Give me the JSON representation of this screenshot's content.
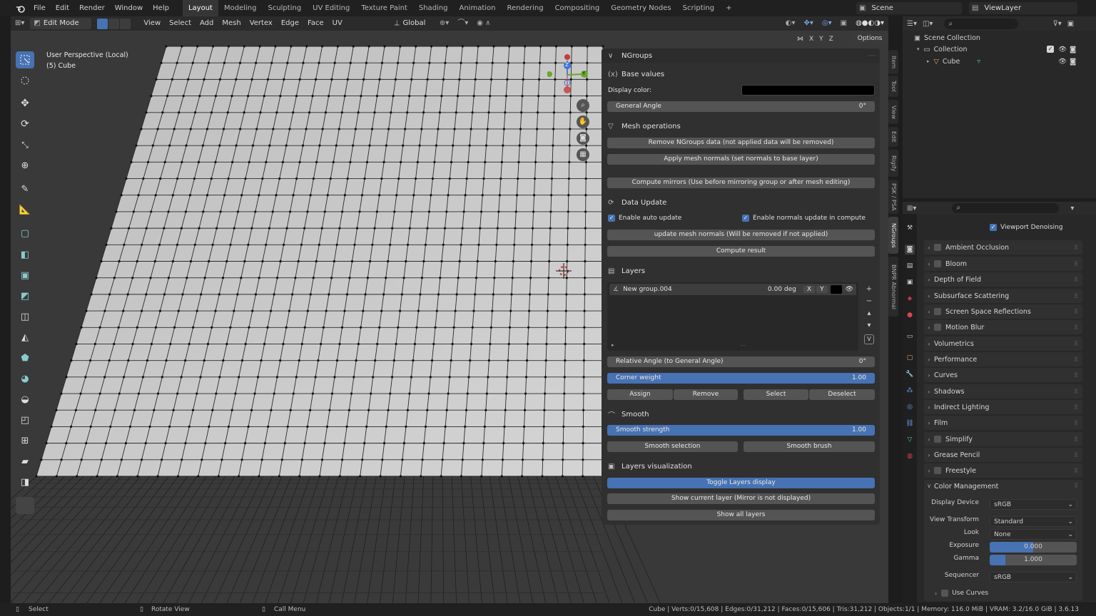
{
  "topbar": {
    "menus": [
      "File",
      "Edit",
      "Render",
      "Window",
      "Help"
    ],
    "workspaces": [
      "Layout",
      "Modeling",
      "Sculpting",
      "UV Editing",
      "Texture Paint",
      "Shading",
      "Animation",
      "Rendering",
      "Compositing",
      "Geometry Nodes",
      "Scripting"
    ],
    "active_workspace": "Layout",
    "add_tab": "+",
    "scene": "Scene",
    "view_layer": "ViewLayer"
  },
  "header": {
    "mode": "Edit Mode",
    "menus": [
      "View",
      "Select",
      "Add",
      "Mesh",
      "Vertex",
      "Edge",
      "Face",
      "UV"
    ],
    "transform_orientation": "Global",
    "options": "Options",
    "axes": [
      "X",
      "Y",
      "Z"
    ]
  },
  "viewport": {
    "perspective": "User Perspective (Local)",
    "object": "(5) Cube",
    "gizmo": {
      "z": "Z",
      "y": "Y"
    }
  },
  "ngroups": {
    "title": "NGroups",
    "base_values": {
      "header": "Base values",
      "display_color_label": "Display color:",
      "display_color": "#000000",
      "general_angle_label": "General Angle",
      "general_angle_value": "0°"
    },
    "mesh_ops": {
      "header": "Mesh operations",
      "remove": "Remove NGroups data (not applied data will be removed)",
      "apply": "Apply mesh normals (set normals to base layer)",
      "mirrors": "Compute mirrors (Use before mirroring group or after mesh editing)"
    },
    "data_update": {
      "header": "Data Update",
      "auto_update": "Enable auto update",
      "normals_update": "Enable normals update in compute",
      "update_normals": "update mesh normals (Will be removed if not applied)",
      "compute": "Compute result"
    },
    "layers": {
      "header": "Layers",
      "item_name": "New group.004",
      "item_angle": "0.00 deg",
      "item_x": "X",
      "item_y": "Y",
      "relative_angle_label": "Relative Angle (to General Angle)",
      "relative_angle_value": "0°",
      "corner_weight_label": "Corner weight",
      "corner_weight_value": "1.00",
      "assign": "Assign",
      "remove": "Remove",
      "select": "Select",
      "deselect": "Deselect"
    },
    "smooth": {
      "header": "Smooth",
      "strength_label": "Smooth strength",
      "strength_value": "1.00",
      "selection": "Smooth selection",
      "brush": "Smooth brush"
    },
    "visualization": {
      "header": "Layers visualization",
      "toggle": "Toggle Layers display",
      "current": "Show current layer (Mirror is not displayed)",
      "all": "Show all layers"
    }
  },
  "sidetabs": [
    "Item",
    "Tool",
    "View",
    "Edit",
    "Rigify",
    "PSK / PSA",
    "NGroups",
    "BNPR Abnormal"
  ],
  "outliner": {
    "scene_collection": "Scene Collection",
    "collection": "Collection",
    "cube": "Cube"
  },
  "properties": {
    "viewport_denoising": "Viewport Denoising",
    "sections": [
      "Ambient Occlusion",
      "Bloom",
      "Depth of Field",
      "Subsurface Scattering",
      "Screen Space Reflections",
      "Motion Blur",
      "Volumetrics",
      "Performance",
      "Curves",
      "Shadows",
      "Indirect Lighting",
      "Film",
      "Simplify",
      "Grease Pencil",
      "Freestyle",
      "Color Management"
    ],
    "color_management": {
      "display_device_label": "Display Device",
      "display_device": "sRGB",
      "view_transform_label": "View Transform",
      "view_transform": "Standard",
      "look_label": "Look",
      "look": "None",
      "exposure_label": "Exposure",
      "exposure": "0.000",
      "gamma_label": "Gamma",
      "gamma": "1.000",
      "sequencer_label": "Sequencer",
      "sequencer": "sRGB",
      "use_curves": "Use Curves"
    }
  },
  "status": {
    "select": "Select",
    "rotate": "Rotate View",
    "call_menu": "Call Menu",
    "stats": "Cube | Verts:0/15,608 | Edges:0/31,212 | Faces:0/15,606 | Tris:31,212 | Objects:1/1 | Memory: 116.0 MiB | VRAM: 3.2/16.0 GiB | 3.6.13"
  }
}
